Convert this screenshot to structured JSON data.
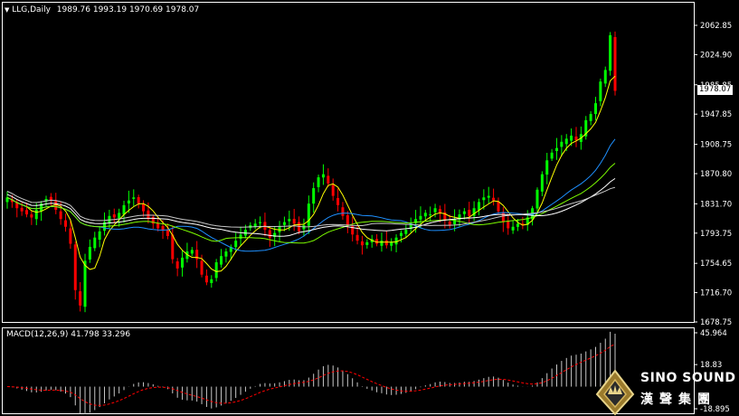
{
  "header": {
    "symbol": "LLG,Daily",
    "ohlc": "1989.76 1993.19 1970.69 1978.07",
    "macd_label": "MACD(12,26,9) 41.798 33.296"
  },
  "colors": {
    "bull": "#00ff00",
    "bear": "#ff0000",
    "ma_yellow": "#ffff00",
    "ma_blue": "#1e90ff",
    "ma_green": "#7cfc00",
    "ma_white": "#ffffff",
    "ma_gray": "#c8c8c8",
    "signal": "#ff0000",
    "histogram": "#c8c8c8"
  },
  "price_axis": {
    "ticks": [
      "2062.85",
      "2024.90",
      "1985.85",
      "1947.85",
      "1908.75",
      "1870.80",
      "1831.70",
      "1793.75",
      "1754.65",
      "1716.70",
      "1678.75"
    ],
    "current_price": "1978.07"
  },
  "macd_axis": {
    "ticks": [
      "45.964",
      "18.83",
      "-18.895"
    ]
  },
  "brand": {
    "name_en": "SINO SOUND",
    "name_cn": "漢聲集團"
  },
  "chart_data": {
    "type": "candlestick",
    "y_range": [
      1678.75,
      2062.85
    ],
    "candles_close_approx": [
      1840,
      1834,
      1826,
      1822,
      1818,
      1814,
      1824,
      1832,
      1838,
      1836,
      1824,
      1812,
      1802,
      1780,
      1720,
      1700,
      1758,
      1776,
      1788,
      1796,
      1808,
      1816,
      1814,
      1820,
      1830,
      1836,
      1840,
      1832,
      1822,
      1812,
      1806,
      1800,
      1798,
      1790,
      1760,
      1748,
      1762,
      1770,
      1772,
      1760,
      1740,
      1730,
      1734,
      1756,
      1764,
      1770,
      1776,
      1784,
      1792,
      1798,
      1804,
      1806,
      1808,
      1798,
      1788,
      1794,
      1802,
      1808,
      1812,
      1806,
      1796,
      1804,
      1832,
      1852,
      1866,
      1870,
      1858,
      1842,
      1830,
      1816,
      1804,
      1792,
      1784,
      1778,
      1782,
      1786,
      1780,
      1784,
      1778,
      1782,
      1788,
      1794,
      1798,
      1806,
      1812,
      1816,
      1820,
      1818,
      1826,
      1820,
      1810,
      1804,
      1812,
      1818,
      1822,
      1816,
      1826,
      1834,
      1840,
      1842,
      1836,
      1822,
      1808,
      1800,
      1802,
      1806,
      1804,
      1814,
      1826,
      1850,
      1870,
      1888,
      1898,
      1904,
      1912,
      1916,
      1920,
      1914,
      1922,
      1940,
      1948,
      1962,
      1990,
      2005,
      2050,
      1978
    ],
    "macd": {
      "value": 41.798,
      "signal": 33.296
    }
  }
}
